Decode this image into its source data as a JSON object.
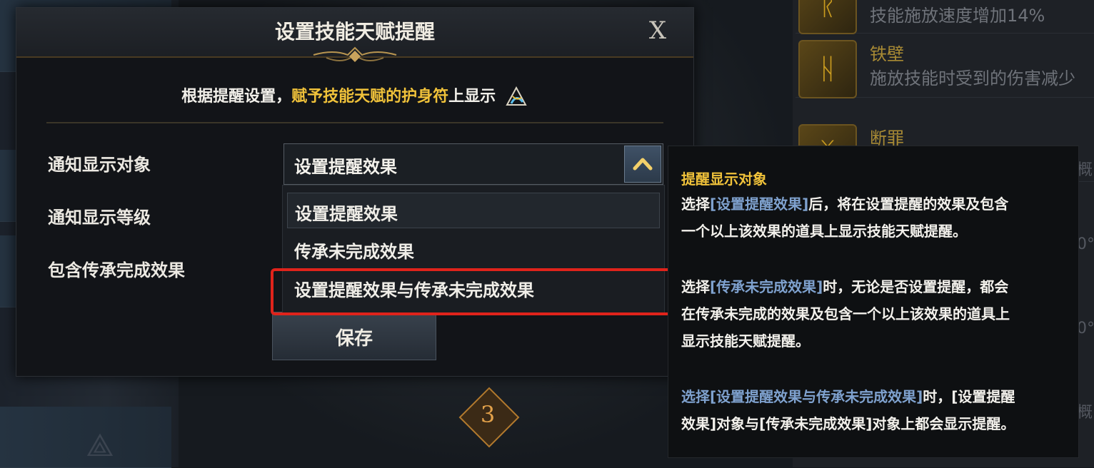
{
  "dialog": {
    "title": "设置技能天赋提醒",
    "close_label": "X",
    "notice_prefix": "根据提醒设置，",
    "notice_highlight": "赋予技能天赋的护身符",
    "notice_suffix": "上显示",
    "rows": {
      "target": "通知显示对象",
      "level": "通知显示等级",
      "inherit": "包含传承完成效果"
    },
    "select_value": "设置提醒效果",
    "options": [
      "设置提醒效果",
      "传承未完成效果",
      "设置提醒效果与传承未完成效果"
    ],
    "save_label": "保存"
  },
  "tooltip": {
    "title": "提醒显示对象",
    "p1_pre": "选择",
    "p1_opt": "[设置提醒效果]",
    "p1_line1_rest": "后，将在设置提醒的效果及包含",
    "p1_line2": "一个以上该效果的道具上显示技能天赋提醒。",
    "p2_pre": "选择",
    "p2_opt": "[传承未完成效果]",
    "p2_line1_rest": "时，无论是否设置提醒，都会",
    "p2_line2": "在传承未完成的效果及包含一个以上该效果的道具上",
    "p2_line3": "显示技能天赋提醒。",
    "p3_opt": "选择[设置提醒效果与传承未完成效果]",
    "p3_line1_rest": "时，[设置提醒",
    "p3_line2": "效果]对象与[传承未完成效果]对象上都会显示提醒。"
  },
  "background": {
    "skills": [
      {
        "name": "",
        "desc": "技能施放速度增加14%"
      },
      {
        "name": "铁壁",
        "desc": "施放技能时受到的伤害减少"
      },
      {
        "name": "断罪",
        "desc": ""
      }
    ],
    "level_badge": "3",
    "side_texts": [
      "概",
      "0°",
      "0°",
      "概"
    ]
  },
  "colors": {
    "highlight": "#f0c23a",
    "option_blue": "#7fa2cf",
    "red_frame": "#e0231b"
  }
}
